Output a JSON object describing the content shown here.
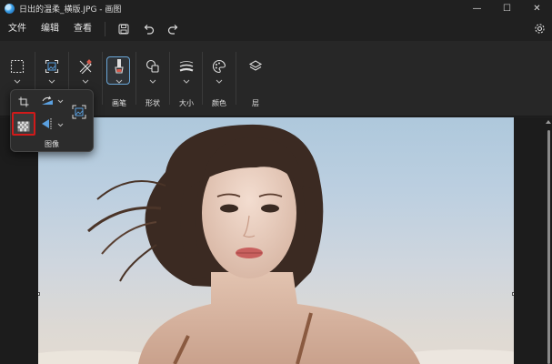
{
  "window": {
    "title": "日出的温柔_横版.JPG - 画图",
    "minimize_glyph": "—",
    "maximize_glyph": "☐",
    "close_glyph": "✕"
  },
  "menu": {
    "items": [
      "文件",
      "编辑",
      "查看"
    ],
    "icons": [
      "save-icon",
      "undo-icon",
      "redo-icon"
    ],
    "settings_icon": "gear-icon"
  },
  "toolbar": {
    "tools": [
      {
        "name": "selection",
        "icon": "dashed-square-icon",
        "label": ""
      },
      {
        "name": "image",
        "icon": "image-frame-icon",
        "label": ""
      },
      {
        "name": "tools",
        "icon": "pencil-eraser-icon",
        "label": ""
      },
      {
        "name": "brushes",
        "icon": "brush-icon",
        "label": "画笔"
      },
      {
        "name": "shapes",
        "icon": "shapes-icon",
        "label": "形状"
      },
      {
        "name": "size",
        "icon": "stroke-size-icon",
        "label": "大小"
      },
      {
        "name": "colors",
        "icon": "palette-icon",
        "label": "颜色"
      },
      {
        "name": "layers",
        "icon": "layers-icon",
        "label": "层"
      }
    ],
    "active_tool": "brushes"
  },
  "image_panel": {
    "label": "图像",
    "items": [
      {
        "icon": "crop-icon"
      },
      {
        "icon": "rotate-icon"
      },
      {
        "icon": "resize-icon"
      },
      {
        "icon": "remove-background-icon",
        "selected": true
      },
      {
        "icon": "flip-icon"
      }
    ]
  },
  "canvas": {
    "image_alt": "日出的温柔_横版.JPG"
  },
  "colors": {
    "accent": "#6aa7d8",
    "highlight": "#d11a1a",
    "background": "#202020"
  }
}
